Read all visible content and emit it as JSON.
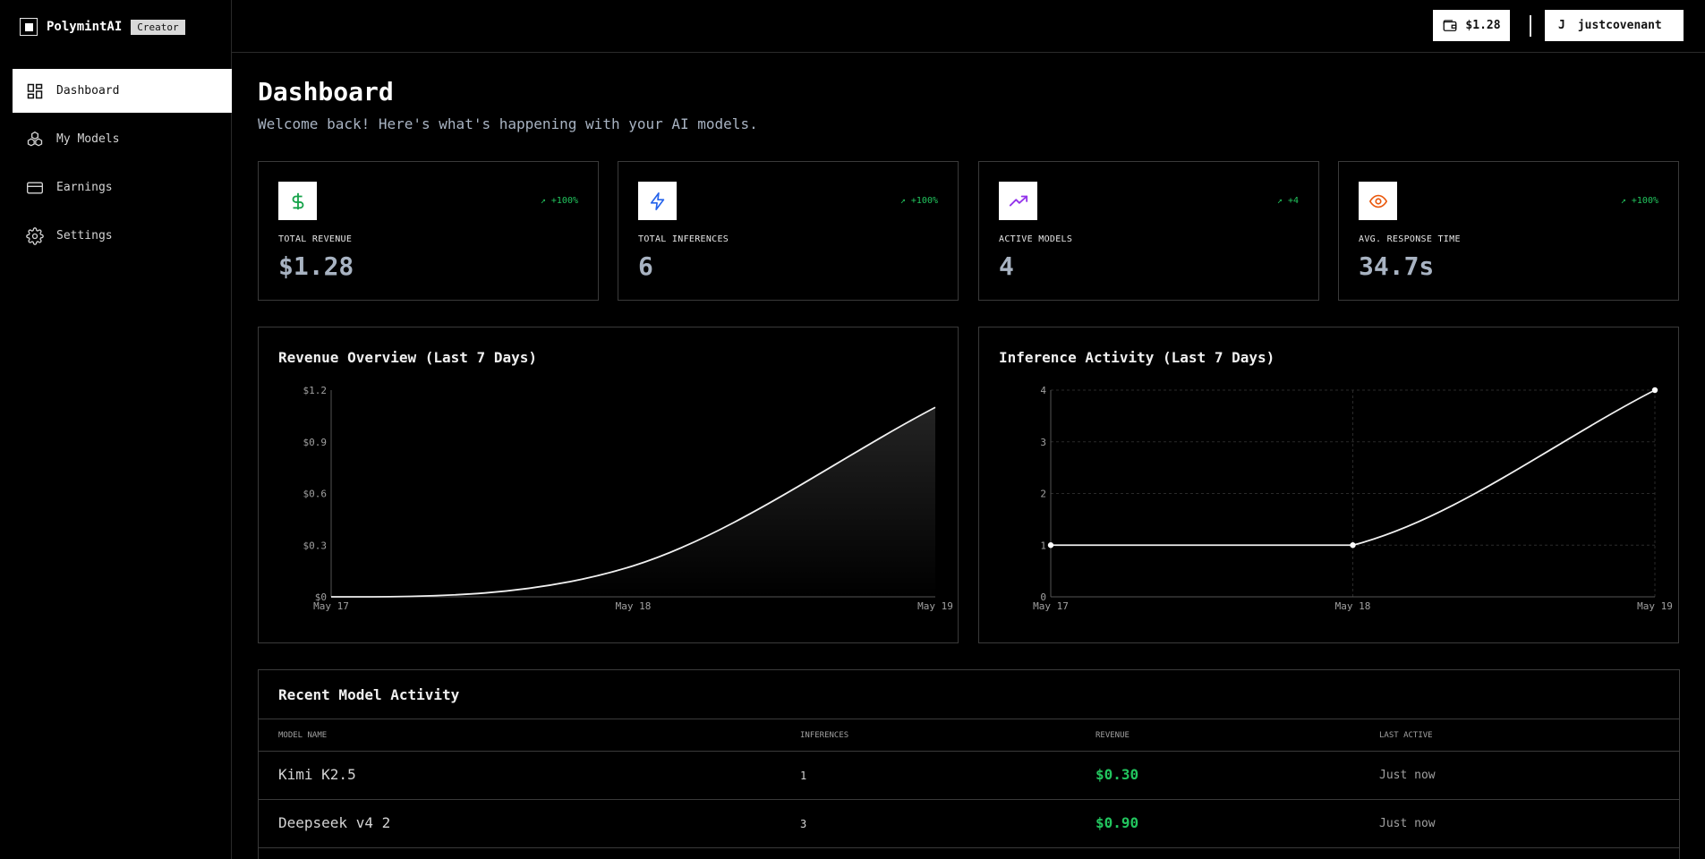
{
  "brand": {
    "name": "PolymintAI",
    "badge": "Creator"
  },
  "sidebar": {
    "items": [
      {
        "label": "Dashboard",
        "icon": "dashboard-icon",
        "active": true
      },
      {
        "label": "My Models",
        "icon": "models-icon",
        "active": false
      },
      {
        "label": "Earnings",
        "icon": "credit-card-icon",
        "active": false
      },
      {
        "label": "Settings",
        "icon": "gear-icon",
        "active": false
      }
    ]
  },
  "topbar": {
    "wallet_balance": "$1.28",
    "user_initial": "J",
    "username": "justcovenant"
  },
  "page": {
    "title": "Dashboard",
    "subtitle": "Welcome back! Here's what's happening with your AI models."
  },
  "stats": [
    {
      "label": "TOTAL REVENUE",
      "value": "$1.28",
      "delta": "↗ +100%",
      "icon": "dollar-icon",
      "icon_color": "#16a34a"
    },
    {
      "label": "TOTAL INFERENCES",
      "value": "6",
      "delta": "↗ +100%",
      "icon": "lightning-icon",
      "icon_color": "#2563eb"
    },
    {
      "label": "ACTIVE MODELS",
      "value": "4",
      "delta": "↗ +4",
      "icon": "trending-up-icon",
      "icon_color": "#9333ea"
    },
    {
      "label": "AVG. RESPONSE TIME",
      "value": "34.7s",
      "delta": "↗ +100%",
      "icon": "eye-icon",
      "icon_color": "#ea580c"
    }
  ],
  "colors": {
    "positive": "#22c55e",
    "accent": "#ffffff",
    "border": "#3a3a3a"
  },
  "chart_data": [
    {
      "type": "area",
      "title": "Revenue Overview (Last 7 Days)",
      "x": [
        "May 17",
        "May 18",
        "May 19"
      ],
      "series": [
        {
          "values": [
            0,
            0.18,
            1.1
          ]
        }
      ],
      "ylim": [
        0,
        1.2
      ],
      "yticks": [
        "$0",
        "$0.3",
        "$0.6",
        "$0.9",
        "$1.2"
      ],
      "ytick_values": [
        0,
        0.3,
        0.6,
        0.9,
        1.2
      ],
      "grid": false
    },
    {
      "type": "line",
      "title": "Inference Activity (Last 7 Days)",
      "x": [
        "May 17",
        "May 18",
        "May 19"
      ],
      "series": [
        {
          "values": [
            1,
            1,
            4
          ]
        }
      ],
      "ylim": [
        0,
        4
      ],
      "yticks": [
        "0",
        "1",
        "2",
        "3",
        "4"
      ],
      "ytick_values": [
        0,
        1,
        2,
        3,
        4
      ],
      "grid": true
    }
  ],
  "activity": {
    "title": "Recent Model Activity",
    "columns": [
      "MODEL NAME",
      "INFERENCES",
      "REVENUE",
      "LAST ACTIVE"
    ],
    "rows": [
      {
        "name": "Kimi K2.5",
        "inferences": "1",
        "revenue": "$0.30",
        "last_active": "Just now"
      },
      {
        "name": "Deepseek v4 2",
        "inferences": "3",
        "revenue": "$0.90",
        "last_active": "Just now"
      }
    ]
  }
}
